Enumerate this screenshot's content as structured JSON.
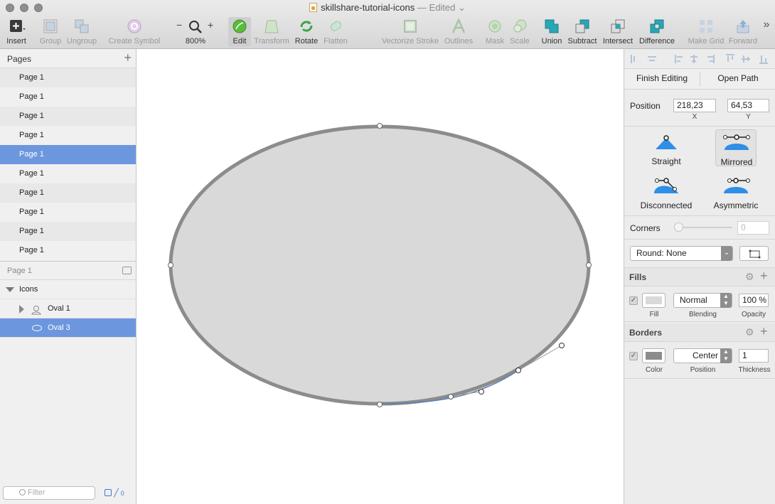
{
  "window": {
    "title": "skillshare-tutorial-icons",
    "status": "— Edited"
  },
  "toolbar": {
    "insert": "Insert",
    "group": "Group",
    "ungroup": "Ungroup",
    "create_symbol": "Create Symbol",
    "zoom_minus": "−",
    "zoom_plus": "+",
    "zoom": "800%",
    "edit": "Edit",
    "transform": "Transform",
    "rotate": "Rotate",
    "flatten": "Flatten",
    "vectorize_stroke": "Vectorize Stroke",
    "outlines": "Outlines",
    "mask": "Mask",
    "scale": "Scale",
    "union": "Union",
    "subtract": "Subtract",
    "intersect": "Intersect",
    "difference": "Difference",
    "make_grid": "Make Grid",
    "forward": "Forward",
    "more": "»"
  },
  "pages": {
    "header": "Pages",
    "add": "+",
    "items": [
      "Page 1",
      "Page 1",
      "Page 1",
      "Page 1",
      "Page 1",
      "Page 1",
      "Page 1",
      "Page 1",
      "Page 1",
      "Page 1"
    ],
    "selected_index": 4
  },
  "layers": {
    "current_page": "Page 1",
    "group": "Icons",
    "items": [
      {
        "name": "Oval 1",
        "icon": "user-icon"
      },
      {
        "name": "Oval 3",
        "icon": "oval-icon"
      }
    ],
    "filter_placeholder": "Filter",
    "edited_count": "0"
  },
  "inspector": {
    "finish_editing": "Finish Editing",
    "open_path": "Open Path",
    "position_label": "Position",
    "x": "218,23",
    "y": "64,53",
    "x_label": "X",
    "y_label": "Y",
    "node_types": [
      "Straight",
      "Mirrored",
      "Disconnected",
      "Asymmetric"
    ],
    "selected_node_type": "Mirrored",
    "corners_label": "Corners",
    "corners_value": "0",
    "round": "Round: None",
    "fills_header": "Fills",
    "fill_label": "Fill",
    "blending": "Normal",
    "blending_label": "Blending",
    "opacity": "100 %",
    "opacity_label": "Opacity",
    "fill_color": "#d9d9d9",
    "borders_header": "Borders",
    "border_color_label": "Color",
    "border_position": "Center",
    "border_position_label": "Position",
    "thickness": "1",
    "thickness_label": "Thickness",
    "border_color": "#8c8c8c"
  },
  "colors": {
    "selection": "#6c97de",
    "accent_blue": "#2f8ee6",
    "shape_fill": "#d9d9d9",
    "shape_stroke": "#8c8c8c"
  }
}
